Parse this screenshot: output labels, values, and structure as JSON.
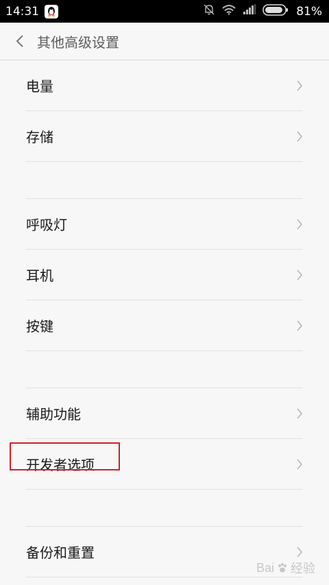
{
  "status_bar": {
    "time": "14:31",
    "battery": "81%",
    "icons": [
      "qq-icon",
      "mute-bell-icon",
      "wifi-icon",
      "signal-icon",
      "battery-icon"
    ]
  },
  "header": {
    "title": "其他高级设置",
    "back_icon": "chevron-left-icon"
  },
  "items": [
    {
      "label": "电量"
    },
    {
      "label": "存储"
    },
    {
      "label": "呼吸灯"
    },
    {
      "label": "耳机"
    },
    {
      "label": "按键"
    },
    {
      "label": "辅助功能"
    },
    {
      "label": "开发者选项"
    },
    {
      "label": "备份和重置"
    }
  ],
  "highlight": {
    "target": "开发者选项",
    "color": "#d0202a"
  },
  "watermark": {
    "text_a": "Bai",
    "text_b": "经验"
  }
}
